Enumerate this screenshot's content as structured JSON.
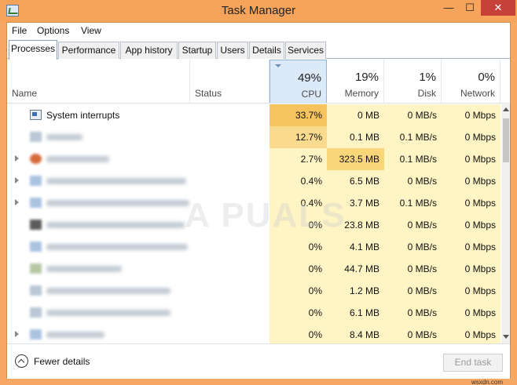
{
  "window": {
    "title": "Task Manager",
    "minimize_glyph": "—",
    "maximize_glyph": "☐",
    "close_glyph": "✕"
  },
  "menu": {
    "items": [
      "File",
      "Options",
      "View"
    ]
  },
  "tabs": [
    "Processes",
    "Performance",
    "App history",
    "Startup",
    "Users",
    "Details",
    "Services"
  ],
  "active_tab": "Processes",
  "columns": {
    "name": "Name",
    "status": "Status",
    "cpu": {
      "pct": "49%",
      "label": "CPU"
    },
    "memory": {
      "pct": "19%",
      "label": "Memory"
    },
    "disk": {
      "pct": "1%",
      "label": "Disk"
    },
    "network": {
      "pct": "0%",
      "label": "Network"
    }
  },
  "processes": [
    {
      "name": "System interrupts",
      "cpu": "33.7%",
      "memory": "0 MB",
      "disk": "0 MB/s",
      "network": "0 Mbps"
    },
    {
      "name": "",
      "cpu": "12.7%",
      "memory": "0.1 MB",
      "disk": "0.1 MB/s",
      "network": "0 Mbps"
    },
    {
      "name": "",
      "cpu": "2.7%",
      "memory": "323.5 MB",
      "disk": "0.1 MB/s",
      "network": "0 Mbps"
    },
    {
      "name": "",
      "cpu": "0.4%",
      "memory": "6.5 MB",
      "disk": "0 MB/s",
      "network": "0 Mbps"
    },
    {
      "name": "",
      "cpu": "0.4%",
      "memory": "3.7 MB",
      "disk": "0.1 MB/s",
      "network": "0 Mbps"
    },
    {
      "name": "",
      "cpu": "0%",
      "memory": "23.8 MB",
      "disk": "0 MB/s",
      "network": "0 Mbps"
    },
    {
      "name": "",
      "cpu": "0%",
      "memory": "4.1 MB",
      "disk": "0 MB/s",
      "network": "0 Mbps"
    },
    {
      "name": "",
      "cpu": "0%",
      "memory": "44.7 MB",
      "disk": "0 MB/s",
      "network": "0 Mbps"
    },
    {
      "name": "",
      "cpu": "0%",
      "memory": "1.2 MB",
      "disk": "0 MB/s",
      "network": "0 Mbps"
    },
    {
      "name": "",
      "cpu": "0%",
      "memory": "6.1 MB",
      "disk": "0 MB/s",
      "network": "0 Mbps"
    },
    {
      "name": "",
      "cpu": "0%",
      "memory": "8.4 MB",
      "disk": "0 MB/s",
      "network": "0 Mbps"
    }
  ],
  "footer": {
    "fewer_details": "Fewer details",
    "end_task": "End task"
  },
  "watermark": "A PUALS",
  "site_mark": "wsxdn.com",
  "colors": {
    "titlebar": "#f6a35c",
    "close_button": "#c7413b",
    "cpu_hot": "#f6c35e",
    "usage_light": "#fff4c4",
    "sort_header": "#dbe9f8"
  }
}
